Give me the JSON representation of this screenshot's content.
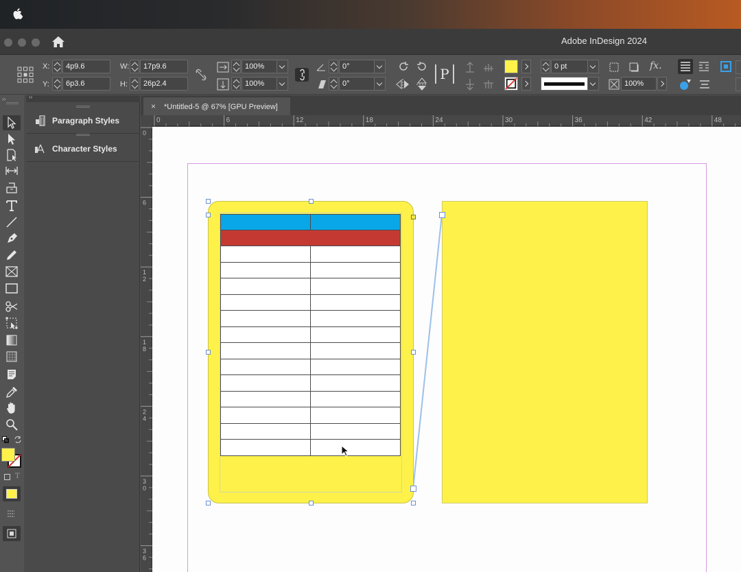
{
  "app": {
    "title": "Adobe InDesign 2024"
  },
  "control_panel": {
    "x_label": "X:",
    "x_value": "4p9.6",
    "y_label": "Y:",
    "y_value": "6p3.6",
    "w_label": "W:",
    "w_value": "17p9.6",
    "h_label": "H:",
    "h_value": "26p2.4",
    "scale_x": "100%",
    "scale_y": "100%",
    "rotation": "0°",
    "shear": "0°",
    "stroke_weight": "0 pt",
    "opacity": "100%",
    "fill_color": "#fef24a"
  },
  "panels": {
    "paragraph_styles": "Paragraph Styles",
    "character_styles": "Character Styles"
  },
  "document": {
    "tab_close": "×",
    "tab_title": "*Untitled-5 @ 67% [GPU Preview]"
  },
  "ruler": {
    "horizontal": [
      "0",
      "6",
      "12",
      "18",
      "24",
      "30",
      "36",
      "42",
      "48"
    ],
    "vertical": [
      "0",
      "6",
      "12",
      "18",
      "24",
      "30",
      "36"
    ]
  },
  "table": {
    "header_color": "#0aa7e8",
    "subheader_color": "#c43a33",
    "columns": 2,
    "body_rows": 13
  },
  "tools": [
    "selection-tool-icon",
    "direct-selection-tool-icon",
    "page-tool-icon",
    "gap-tool-icon",
    "content-collector-icon",
    "type-tool-icon",
    "line-tool-icon",
    "pen-tool-icon",
    "pencil-tool-icon",
    "rectangle-frame-tool-icon",
    "rectangle-tool-icon",
    "scissors-tool-icon",
    "free-transform-tool-icon",
    "gradient-swatch-tool-icon",
    "gradient-feather-tool-icon",
    "note-tool-icon",
    "eyedropper-tool-icon",
    "hand-tool-icon",
    "zoom-tool-icon"
  ]
}
